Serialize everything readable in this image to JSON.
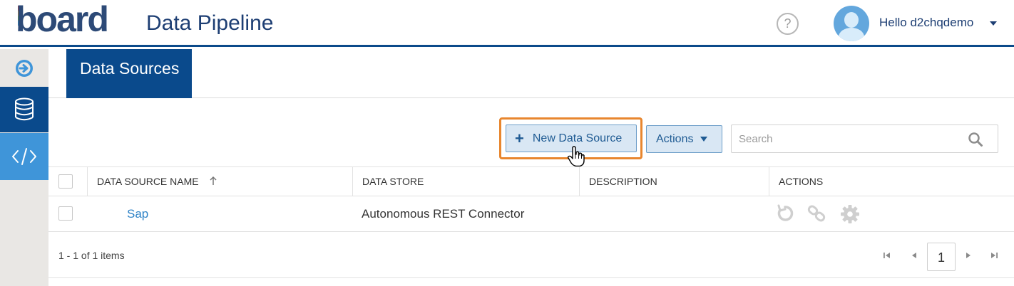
{
  "header": {
    "logo_text": "board",
    "app_title": "Data Pipeline",
    "help_label": "?",
    "user_greeting": "Hello d2chqdemo"
  },
  "sidebar": {
    "items": [
      {
        "name": "collapse",
        "icon": "arrow-right-circle-icon"
      },
      {
        "name": "data-sources",
        "icon": "database-icon",
        "active": true
      },
      {
        "name": "code",
        "icon": "code-icon"
      }
    ]
  },
  "tabs": [
    {
      "label": "Data Sources",
      "active": true
    }
  ],
  "toolbar": {
    "new_label": "New Data Source",
    "actions_label": "Actions",
    "search_placeholder": "Search"
  },
  "table": {
    "columns": [
      "DATA SOURCE NAME",
      "DATA STORE",
      "DESCRIPTION",
      "ACTIONS"
    ],
    "rows": [
      {
        "name": "Sap",
        "store": "Autonomous REST Connector",
        "description": ""
      }
    ]
  },
  "pager": {
    "info": "1 - 1 of 1 items",
    "current_page": "1"
  },
  "colors": {
    "brand_navy": "#0a4a8c",
    "accent_blue": "#3f95d9",
    "highlight_orange": "#e8862e",
    "link_blue": "#2d82c6"
  }
}
